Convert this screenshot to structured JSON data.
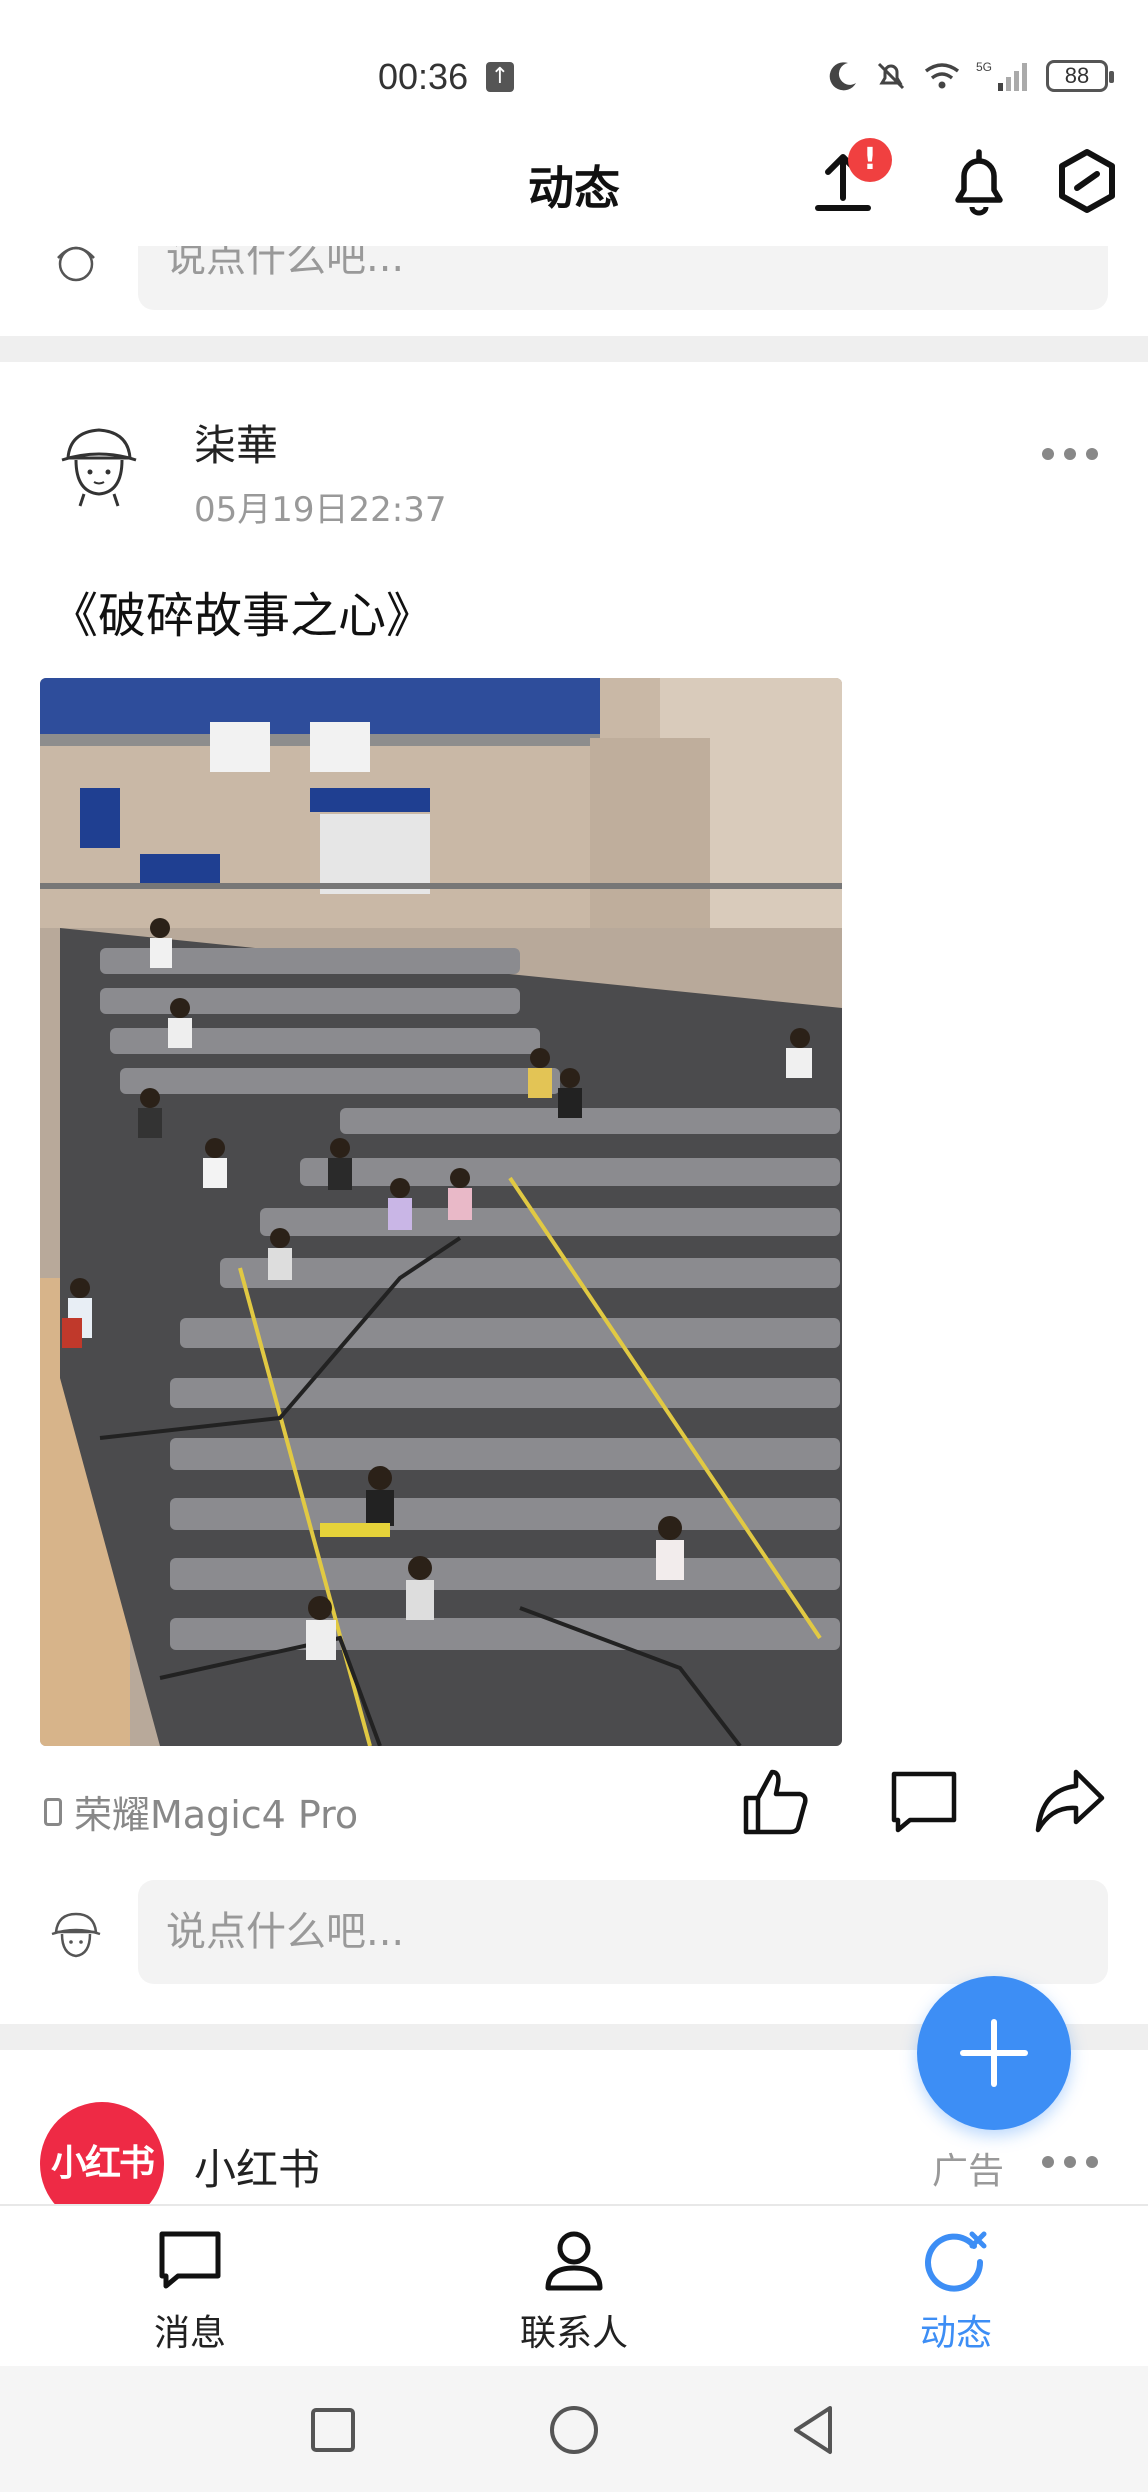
{
  "status_bar": {
    "time": "00:36",
    "battery": "88",
    "network": "5G"
  },
  "header": {
    "title": "动态",
    "upload_badge": "!"
  },
  "comment_placeholder_top": "说点什么吧...",
  "post": {
    "author": "柒華",
    "time": "05月19日22:37",
    "text": "《破碎故事之心》",
    "device": "荣耀Magic4 Pro",
    "comment_placeholder": "说点什么吧..."
  },
  "ad": {
    "name": "小红书",
    "logo_text": "小红书",
    "label": "广告"
  },
  "bottom_nav": [
    {
      "label": "消息",
      "icon": "message-icon",
      "active": false
    },
    {
      "label": "联系人",
      "icon": "contact-icon",
      "active": false
    },
    {
      "label": "动态",
      "icon": "moments-icon",
      "active": true
    }
  ],
  "colors": {
    "accent": "#3d8ef5",
    "badge": "#f04040",
    "ad_brand": "#ee2a45"
  }
}
